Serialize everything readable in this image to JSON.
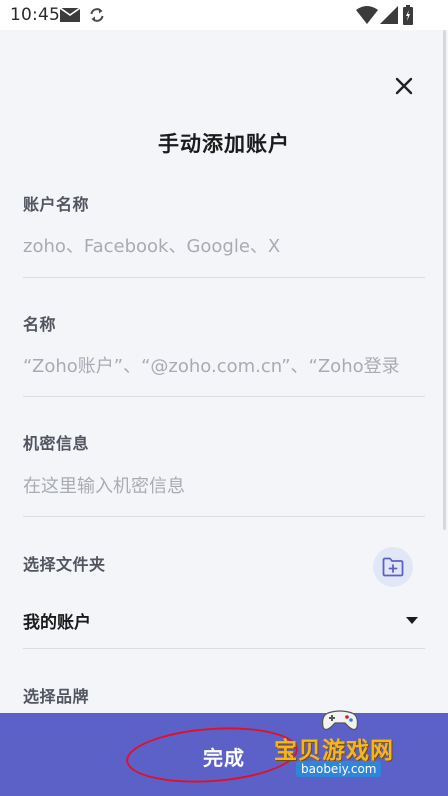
{
  "status_bar": {
    "time": "10:45",
    "icons": [
      "mail-icon",
      "sync-icon",
      "wifi-icon",
      "signal-icon",
      "battery-icon"
    ]
  },
  "dialog": {
    "title": "手动添加账户",
    "close_icon": "close-icon"
  },
  "fields": {
    "account_name": {
      "label": "账户名称",
      "placeholder": "zoho、Facebook、Google、X"
    },
    "name": {
      "label": "名称",
      "placeholder": "“Zoho账户”、“@zoho.com.cn”、“Zoho登录"
    },
    "secret": {
      "label": "机密信息",
      "placeholder": "在这里输入机密信息"
    },
    "folder": {
      "label": "选择文件夹",
      "value": "我的账户",
      "add_icon": "folder-plus-icon",
      "dropdown_icon": "caret-down-icon"
    },
    "brand": {
      "label": "选择品牌"
    }
  },
  "footer": {
    "done_label": "完成"
  },
  "watermark": {
    "title": "宝贝游戏网",
    "url": "baobeiy.com"
  },
  "colors": {
    "background": "#f4f5f9",
    "accent": "#5c61c7",
    "folder_button_bg": "#e2e7f7",
    "annotation_red": "#e0102a"
  }
}
